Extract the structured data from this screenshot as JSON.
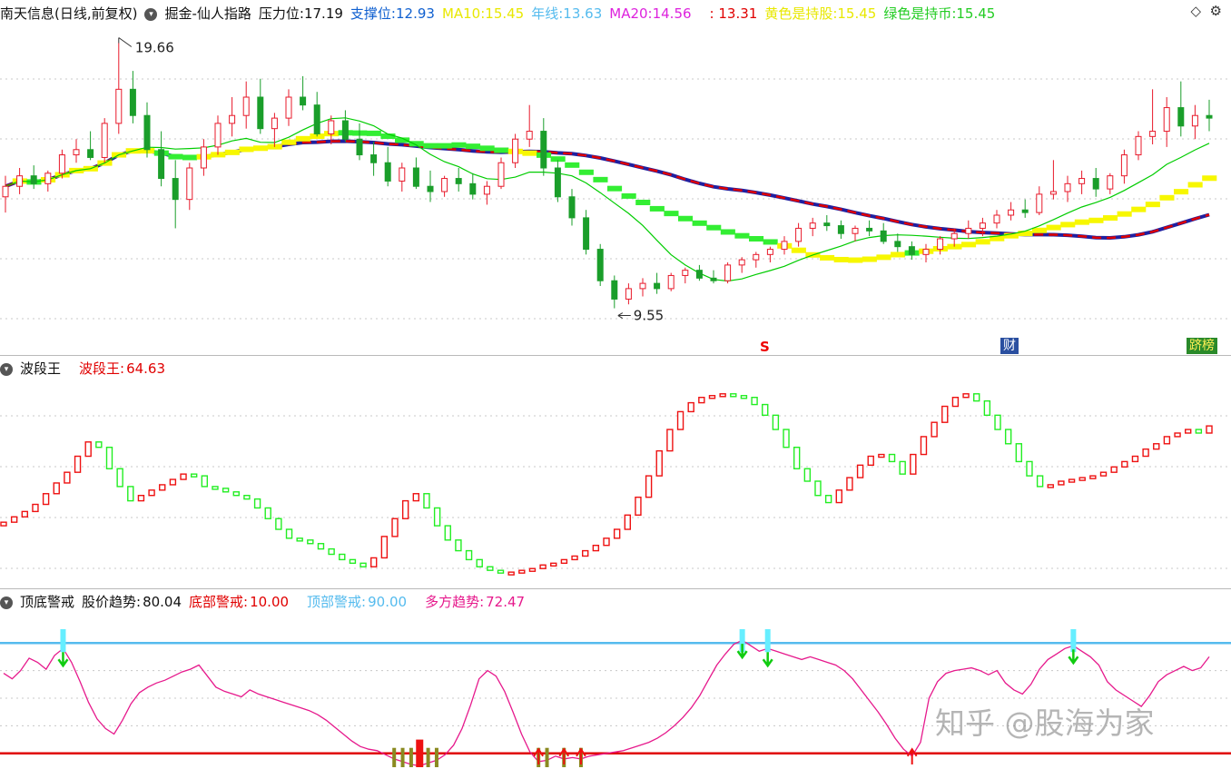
{
  "colors": {
    "up": "#e8192a",
    "down": "#1a9e2a",
    "ma_green": "#00cc00",
    "ma_yellow": "#f7f700",
    "ma_red": "#e00000",
    "ma_blue": "#2020a0",
    "ribbon_green": "#33ee33",
    "wave_up": "#ee1111",
    "wave_down": "#22ee22",
    "alert_line": "#e6198c",
    "top_line": "#55bbee",
    "bottom_line": "#e00000"
  },
  "header": {
    "title": "南天信息(日线,前复权)",
    "indicator": "掘金-仙人指路",
    "pressure_label": "压力位:",
    "pressure_value": "17.19",
    "support_label": "支撑位:",
    "support_value": "12.93",
    "ma10_label": "MA10:",
    "ma10_value": "15.45",
    "year_label": "年线:",
    "year_value": "13.63",
    "ma20_label": "MA20:",
    "ma20_value": "14.56",
    "extra_value": ": 13.31",
    "yellow_label": "黄色是持股:",
    "yellow_value": "15.45",
    "green_label": "绿色是持币:",
    "green_value": "15.45",
    "ctrl_icons": [
      "diamond-icon",
      "gear-icon"
    ]
  },
  "chart_data": [
    {
      "type": "candlestick",
      "title": "南天信息(日线,前复权)",
      "annotations": [
        {
          "label": "19.66",
          "kind": "high"
        },
        {
          "label": "9.55",
          "kind": "low"
        }
      ],
      "markers": [
        "S",
        "财",
        "跻榜"
      ],
      "ohlc": [
        [
          13.8,
          14.6,
          13.2,
          14.2
        ],
        [
          14.2,
          14.9,
          13.9,
          14.6
        ],
        [
          14.6,
          15.0,
          14.1,
          14.3
        ],
        [
          14.3,
          14.8,
          14.0,
          14.7
        ],
        [
          14.7,
          15.6,
          14.5,
          15.4
        ],
        [
          15.4,
          16.0,
          15.1,
          15.6
        ],
        [
          15.6,
          16.3,
          15.2,
          15.3
        ],
        [
          15.3,
          16.8,
          15.1,
          16.6
        ],
        [
          16.6,
          19.66,
          16.2,
          17.9
        ],
        [
          17.9,
          18.6,
          16.6,
          16.9
        ],
        [
          16.9,
          17.4,
          15.3,
          15.6
        ],
        [
          15.6,
          16.3,
          14.2,
          14.5
        ],
        [
          14.5,
          15.2,
          12.6,
          13.7
        ],
        [
          13.7,
          15.1,
          13.3,
          14.9
        ],
        [
          14.9,
          16.0,
          14.6,
          15.7
        ],
        [
          15.7,
          16.9,
          15.4,
          16.6
        ],
        [
          16.6,
          17.6,
          16.1,
          16.9
        ],
        [
          16.9,
          18.2,
          16.4,
          17.6
        ],
        [
          17.6,
          18.3,
          16.2,
          16.4
        ],
        [
          16.4,
          17.0,
          15.7,
          16.8
        ],
        [
          16.8,
          17.9,
          16.5,
          17.6
        ],
        [
          17.6,
          18.4,
          17.1,
          17.3
        ],
        [
          17.3,
          17.8,
          16.1,
          16.2
        ],
        [
          16.2,
          16.9,
          15.8,
          16.7
        ],
        [
          16.7,
          17.1,
          15.9,
          16.0
        ],
        [
          16.0,
          16.6,
          15.2,
          15.4
        ],
        [
          15.4,
          15.9,
          14.6,
          15.1
        ],
        [
          15.1,
          15.7,
          14.2,
          14.4
        ],
        [
          14.4,
          15.1,
          14.0,
          14.9
        ],
        [
          14.9,
          15.3,
          14.1,
          14.2
        ],
        [
          14.2,
          14.8,
          13.6,
          14.0
        ],
        [
          14.0,
          14.6,
          13.8,
          14.5
        ],
        [
          14.5,
          14.9,
          14.0,
          14.3
        ],
        [
          14.3,
          14.7,
          13.7,
          13.9
        ],
        [
          13.9,
          14.4,
          13.5,
          14.2
        ],
        [
          14.2,
          15.3,
          14.1,
          15.1
        ],
        [
          15.1,
          16.2,
          14.9,
          16.0
        ],
        [
          16.0,
          17.3,
          15.7,
          16.3
        ],
        [
          16.3,
          16.8,
          14.6,
          14.9
        ],
        [
          14.9,
          15.2,
          13.6,
          13.8
        ],
        [
          13.8,
          14.1,
          12.7,
          13.0
        ],
        [
          13.0,
          13.3,
          11.6,
          11.8
        ],
        [
          11.8,
          12.0,
          10.4,
          10.6
        ],
        [
          10.6,
          10.8,
          9.55,
          9.9
        ],
        [
          9.9,
          10.5,
          9.7,
          10.3
        ],
        [
          10.3,
          10.7,
          10.0,
          10.5
        ],
        [
          10.5,
          10.9,
          10.1,
          10.3
        ],
        [
          10.3,
          10.9,
          10.2,
          10.8
        ],
        [
          10.8,
          11.1,
          10.5,
          11.0
        ],
        [
          11.0,
          11.2,
          10.6,
          10.7
        ],
        [
          10.7,
          11.0,
          10.5,
          10.6
        ],
        [
          10.6,
          11.3,
          10.5,
          11.2
        ],
        [
          11.2,
          11.5,
          10.9,
          11.4
        ],
        [
          11.4,
          11.7,
          11.1,
          11.6
        ],
        [
          11.6,
          11.9,
          11.3,
          11.8
        ],
        [
          11.8,
          12.3,
          11.6,
          12.1
        ],
        [
          12.1,
          12.8,
          11.9,
          12.6
        ],
        [
          12.6,
          13.0,
          12.3,
          12.8
        ],
        [
          12.8,
          13.1,
          12.5,
          12.7
        ],
        [
          12.7,
          12.9,
          12.2,
          12.4
        ],
        [
          12.4,
          12.7,
          12.1,
          12.6
        ],
        [
          12.6,
          12.9,
          12.3,
          12.5
        ],
        [
          12.5,
          12.8,
          12.0,
          12.1
        ],
        [
          12.1,
          12.4,
          11.7,
          11.9
        ],
        [
          11.9,
          12.1,
          11.4,
          11.6
        ],
        [
          11.6,
          12.0,
          11.3,
          11.8
        ],
        [
          11.8,
          12.3,
          11.6,
          12.2
        ],
        [
          12.2,
          12.6,
          11.9,
          12.4
        ],
        [
          12.4,
          12.9,
          12.2,
          12.6
        ],
        [
          12.6,
          13.0,
          12.3,
          12.8
        ],
        [
          12.8,
          13.3,
          12.6,
          13.1
        ],
        [
          13.1,
          13.6,
          12.9,
          13.3
        ],
        [
          13.3,
          13.7,
          13.0,
          13.2
        ],
        [
          13.2,
          14.2,
          13.1,
          13.9
        ],
        [
          13.9,
          15.2,
          13.7,
          14.0
        ],
        [
          14.0,
          14.6,
          13.6,
          14.3
        ],
        [
          14.3,
          14.8,
          13.9,
          14.5
        ],
        [
          14.5,
          14.9,
          13.8,
          14.1
        ],
        [
          14.1,
          14.7,
          13.9,
          14.6
        ],
        [
          14.6,
          15.6,
          14.3,
          15.4
        ],
        [
          15.4,
          16.3,
          15.2,
          16.1
        ],
        [
          16.1,
          17.9,
          15.8,
          16.3
        ],
        [
          16.3,
          17.6,
          15.7,
          17.2
        ],
        [
          17.2,
          18.2,
          16.1,
          16.5
        ],
        [
          16.5,
          17.3,
          16.0,
          16.9
        ],
        [
          16.9,
          17.5,
          16.3,
          16.8
        ]
      ]
    },
    {
      "type": "bar",
      "title": "波段王",
      "series_label": "波段王:",
      "last_value": "64.63",
      "values": [
        10,
        13,
        16,
        20,
        26,
        32,
        38,
        47,
        55,
        52,
        40,
        30,
        22,
        25,
        28,
        31,
        34,
        37,
        36,
        30,
        29,
        27,
        25,
        23,
        18,
        12,
        6,
        1,
        0,
        -2,
        -5,
        -8,
        -11,
        -13,
        -15,
        -10,
        2,
        12,
        22,
        26,
        18,
        8,
        0,
        -6,
        -11,
        -15,
        -17,
        -18,
        -18,
        -17,
        -16,
        -14,
        -13,
        -11,
        -9,
        -6,
        -3,
        1,
        6,
        14,
        24,
        36,
        50,
        62,
        72,
        77,
        80,
        81,
        82,
        81,
        80,
        76,
        70,
        62,
        52,
        40,
        33,
        25,
        21,
        28,
        35,
        42,
        47,
        48,
        44,
        37,
        48,
        58,
        66,
        75,
        80,
        82,
        78,
        70,
        62,
        54,
        44,
        36,
        30,
        31,
        33,
        34,
        35,
        36,
        38,
        41,
        44,
        47,
        51,
        54,
        58,
        60,
        62,
        60,
        64
      ]
    },
    {
      "type": "line",
      "title": "顶底警戒",
      "series": [
        {
          "name": "股价趋势",
          "last_value": "80.04"
        },
        {
          "name": "底部警戒",
          "last_value": "10.00"
        },
        {
          "name": "顶部警戒",
          "last_value": "90.00"
        },
        {
          "name": "多方趋势",
          "last_value": "72.47"
        }
      ],
      "ylim": [
        0,
        100
      ],
      "top_line": 90,
      "bottom_line": 10,
      "values": [
        68,
        64,
        70,
        79,
        76,
        71,
        81,
        86,
        76,
        62,
        47,
        35,
        28,
        24,
        34,
        46,
        54,
        58,
        61,
        63,
        66,
        69,
        71,
        74,
        66,
        58,
        55,
        53,
        51,
        56,
        53,
        51,
        49,
        47,
        45,
        43,
        41,
        38,
        34,
        29,
        24,
        19,
        15,
        13,
        12,
        9,
        6,
        4,
        2,
        1,
        3,
        5,
        9,
        16,
        28,
        45,
        64,
        70,
        66,
        55,
        40,
        24,
        11,
        4,
        5,
        8,
        6,
        7,
        6,
        8,
        9,
        10,
        11,
        12,
        14,
        16,
        18,
        21,
        25,
        30,
        36,
        43,
        52,
        63,
        74,
        82,
        89,
        92,
        88,
        84,
        86,
        84,
        82,
        80,
        78,
        80,
        78,
        76,
        74,
        70,
        64,
        56,
        48,
        40,
        31,
        21,
        13,
        8,
        18,
        50,
        62,
        68,
        70,
        71,
        72,
        70,
        67,
        70,
        61,
        56,
        53,
        60,
        71,
        78,
        82,
        86,
        88,
        84,
        80,
        74,
        62,
        56,
        52,
        48,
        44,
        52,
        62,
        67,
        70,
        73,
        70,
        72,
        80
      ]
    }
  ],
  "subpanel1": {
    "title": "波段王",
    "label": "波段王:",
    "value": "64.63"
  },
  "subpanel2": {
    "title": "顶底警戒",
    "trend_label": "股价趋势:",
    "trend_value": "80.04",
    "bottom_label": "底部警戒:",
    "bottom_value": "10.00",
    "top_label": "顶部警戒:",
    "top_value": "90.00",
    "multi_label": "多方趋势:",
    "multi_value": "72.47"
  },
  "markers": {
    "sell": "S",
    "finance": "财",
    "rank": "跻榜"
  },
  "watermark": "知乎 @股海为家"
}
